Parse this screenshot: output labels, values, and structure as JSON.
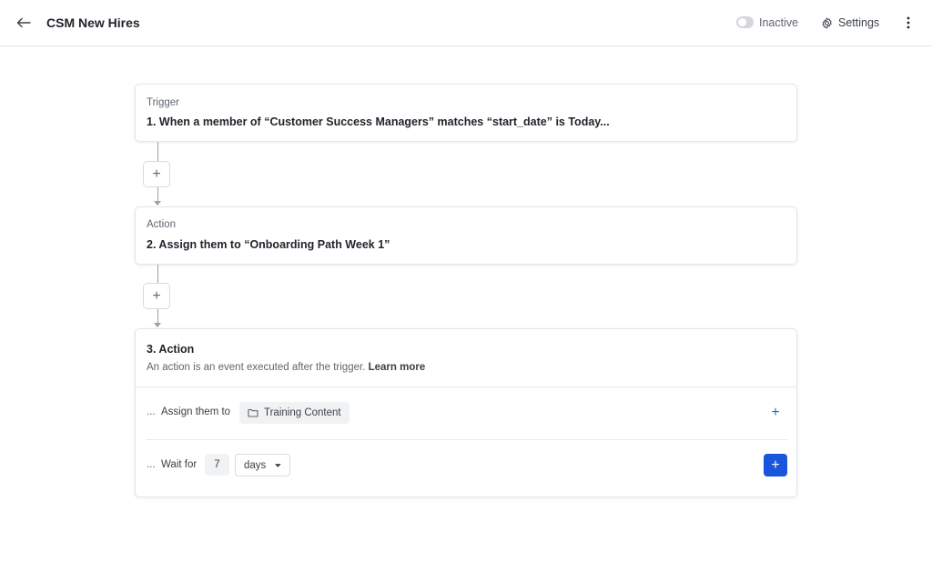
{
  "header": {
    "title": "CSM New Hires",
    "status_label": "Inactive",
    "settings_label": "Settings"
  },
  "steps": [
    {
      "kind_label": "Trigger",
      "text": "1. When a member of “Customer Success Managers” matches “start_date” is Today..."
    },
    {
      "kind_label": "Action",
      "text": "2. Assign them to “Onboarding Path Week 1”"
    }
  ],
  "action_editor": {
    "title": "3. Action",
    "description": "An action is an event executed after the trigger.",
    "learn_more": "Learn more",
    "rows": [
      {
        "prefix": "...",
        "verb": "Assign them to",
        "target": "Training Content"
      },
      {
        "prefix": "...",
        "verb": "Wait for",
        "amount": "7",
        "unit": "days"
      }
    ]
  },
  "colors": {
    "primary": "#1a56db",
    "link": "#2b67d8",
    "border": "#e3e5e8"
  },
  "icons": {
    "back": "arrow-left-icon",
    "settings": "gear-icon",
    "more": "kebab-icon",
    "folder": "folder-icon",
    "add": "plus-icon",
    "dropdown": "caret-down-icon"
  }
}
